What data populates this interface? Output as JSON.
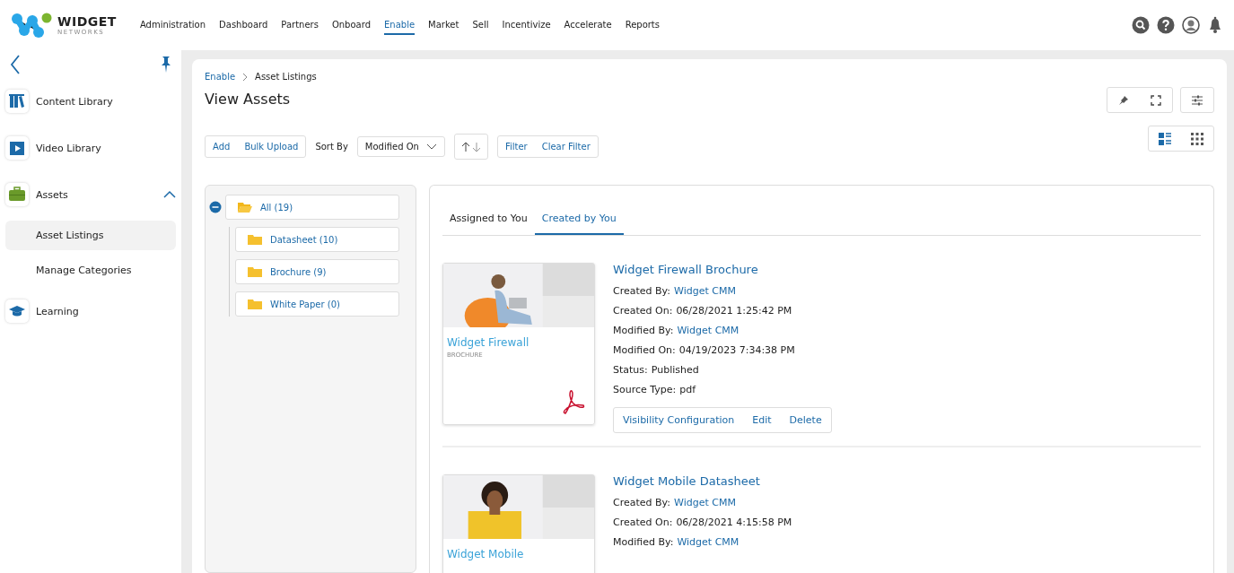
{
  "logo": {
    "name": "WIDGET",
    "tagline": "NETWORKS"
  },
  "nav": [
    {
      "label": "Administration",
      "selected": false
    },
    {
      "label": "Dashboard",
      "selected": false
    },
    {
      "label": "Partners",
      "selected": false
    },
    {
      "label": "Onboard",
      "selected": false
    },
    {
      "label": "Enable",
      "selected": true
    },
    {
      "label": "Market",
      "selected": false
    },
    {
      "label": "Sell",
      "selected": false
    },
    {
      "label": "Incentivize",
      "selected": false
    },
    {
      "label": "Accelerate",
      "selected": false
    },
    {
      "label": "Reports",
      "selected": false
    }
  ],
  "sidebar": {
    "items": [
      {
        "label": "Content Library"
      },
      {
        "label": "Video Library"
      },
      {
        "label": "Assets",
        "expanded": true,
        "children": [
          {
            "label": "Asset Listings",
            "selected": true
          },
          {
            "label": "Manage Categories",
            "selected": false
          }
        ]
      },
      {
        "label": "Learning"
      }
    ]
  },
  "breadcrumb": [
    "Enable",
    "Asset Listings"
  ],
  "page_title": "View Assets",
  "toolbar": {
    "actions": [
      "Add",
      "Bulk Upload"
    ],
    "sort_label": "Sort By",
    "sort_value": "Modified On",
    "filters": [
      "Filter",
      "Clear Filter"
    ]
  },
  "view_modes": [
    {
      "kind": "list",
      "selected": true
    },
    {
      "kind": "grid",
      "selected": false
    }
  ],
  "tree": {
    "label": "All (19)",
    "expanded": true,
    "children": [
      {
        "label": "Datasheet (10)"
      },
      {
        "label": "Brochure (9)"
      },
      {
        "label": "White Paper (0)"
      }
    ]
  },
  "tabs": [
    {
      "label": "Assigned to You",
      "selected": false
    },
    {
      "label": "Created by You",
      "selected": true
    }
  ],
  "assets": [
    {
      "title": "Widget Firewall Brochure",
      "thumb_title": "Widget Firewall",
      "thumb_subtitle": "BROCHURE",
      "fields": [
        {
          "label": "Created By:",
          "value": "Widget CMM",
          "kind": "link"
        },
        {
          "label": "Created On:",
          "value": "06/28/2021 1:25:42 PM",
          "kind": "text"
        },
        {
          "label": "Modified By:",
          "value": "Widget CMM",
          "kind": "link"
        },
        {
          "label": "Modified On:",
          "value": "04/19/2023 7:34:38 PM",
          "kind": "text"
        },
        {
          "label": "Status:",
          "value": "Published",
          "kind": "text"
        },
        {
          "label": "Source Type:",
          "value": "pdf",
          "kind": "text"
        }
      ],
      "actions": [
        "Visibility Configuration",
        "Edit",
        "Delete"
      ]
    },
    {
      "title": "Widget Mobile Datasheet",
      "thumb_title": "Widget Mobile",
      "fields": [
        {
          "label": "Created By:",
          "value": "Widget CMM",
          "kind": "link"
        },
        {
          "label": "Created On:",
          "value": "06/28/2021 4:15:58 PM",
          "kind": "text"
        },
        {
          "label": "Modified By:",
          "value": "Widget CMM",
          "kind": "link"
        }
      ]
    }
  ]
}
